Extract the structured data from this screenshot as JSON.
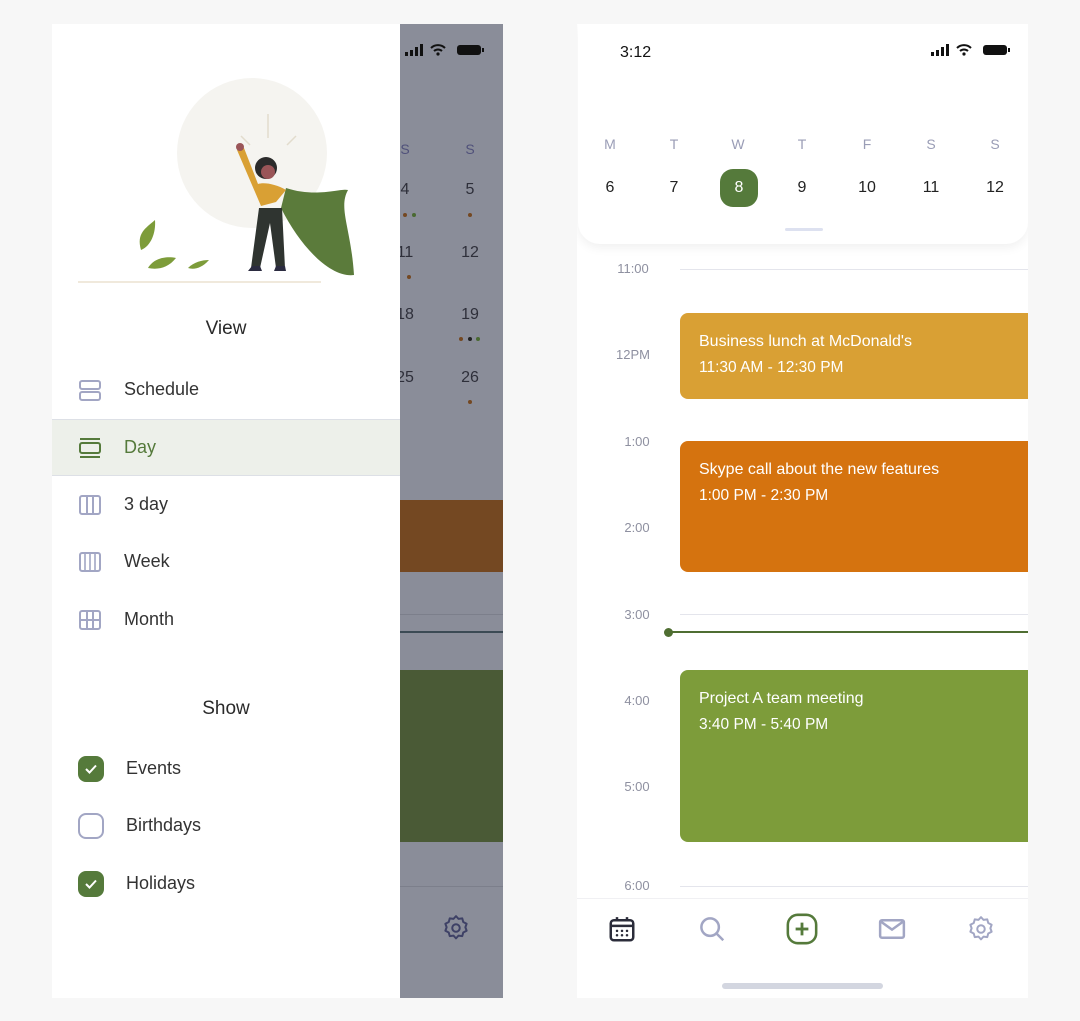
{
  "drawer": {
    "view_title": "View",
    "view_items": [
      {
        "label": "Schedule",
        "icon": "schedule-icon",
        "selected": false
      },
      {
        "label": "Day",
        "icon": "day-view-icon",
        "selected": true
      },
      {
        "label": "3 day",
        "icon": "three-day-icon",
        "selected": false
      },
      {
        "label": "Week",
        "icon": "week-icon",
        "selected": false
      },
      {
        "label": "Month",
        "icon": "month-icon",
        "selected": false
      }
    ],
    "show_title": "Show",
    "show_items": [
      {
        "label": "Events",
        "checked": true
      },
      {
        "label": "Birthdays",
        "checked": false
      },
      {
        "label": "Holidays",
        "checked": true
      }
    ]
  },
  "background_calendar": {
    "day_headers": [
      "S",
      "S"
    ],
    "rows": [
      [
        "4",
        "5"
      ],
      [
        "11",
        "12"
      ],
      [
        "18",
        "19"
      ],
      [
        "25",
        "26"
      ]
    ]
  },
  "phone": {
    "status_time": "3:12",
    "week_days": [
      "M",
      "T",
      "W",
      "T",
      "F",
      "S",
      "S"
    ],
    "week_dates": [
      "6",
      "7",
      "8",
      "9",
      "10",
      "11",
      "12"
    ],
    "selected_date": "8",
    "hours": [
      "11:00",
      "12PM",
      "1:00",
      "2:00",
      "3:00",
      "4:00",
      "5:00",
      "6:00"
    ],
    "events": [
      {
        "title": "Business lunch at McDonald's",
        "time": "11:30 AM - 12:30 PM",
        "color": "#d9a034"
      },
      {
        "title": "Skype call about the new features",
        "time": "1:00 PM - 2:30 PM",
        "color": "#d5730f"
      },
      {
        "title": "Project A team meeting",
        "time": "3:40 PM - 5:40 PM",
        "color": "#7d9c3a"
      }
    ],
    "accent": "#557a3b",
    "nav": [
      "calendar-icon",
      "search-icon",
      "add-icon",
      "mail-icon",
      "gear-icon"
    ]
  }
}
